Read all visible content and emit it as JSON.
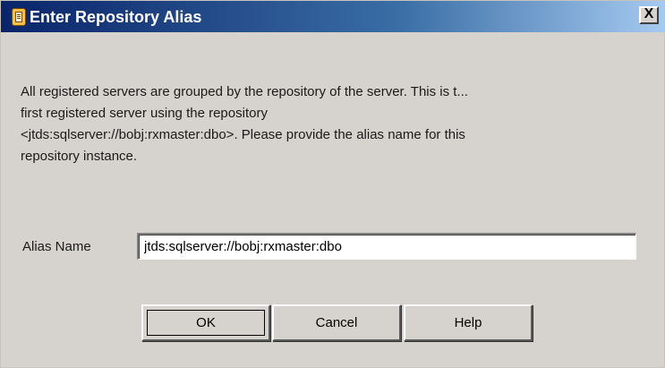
{
  "window": {
    "title": "Enter Repository Alias",
    "close_label": "X"
  },
  "message": {
    "lines": [
      "All registered servers are grouped by the repository of the server. This is t...",
      " first registered server using the repository",
      "<jtds:sqlserver://bobj:rxmaster:dbo>. Please provide the alias name for this",
      "repository instance."
    ]
  },
  "alias": {
    "label": "Alias Name",
    "value": "jtds:sqlserver://bobj:rxmaster:dbo"
  },
  "buttons": {
    "ok": "OK",
    "cancel": "Cancel",
    "help": "Help"
  },
  "icons": {
    "title_icon": "repository-icon",
    "close_icon": "close-icon"
  }
}
